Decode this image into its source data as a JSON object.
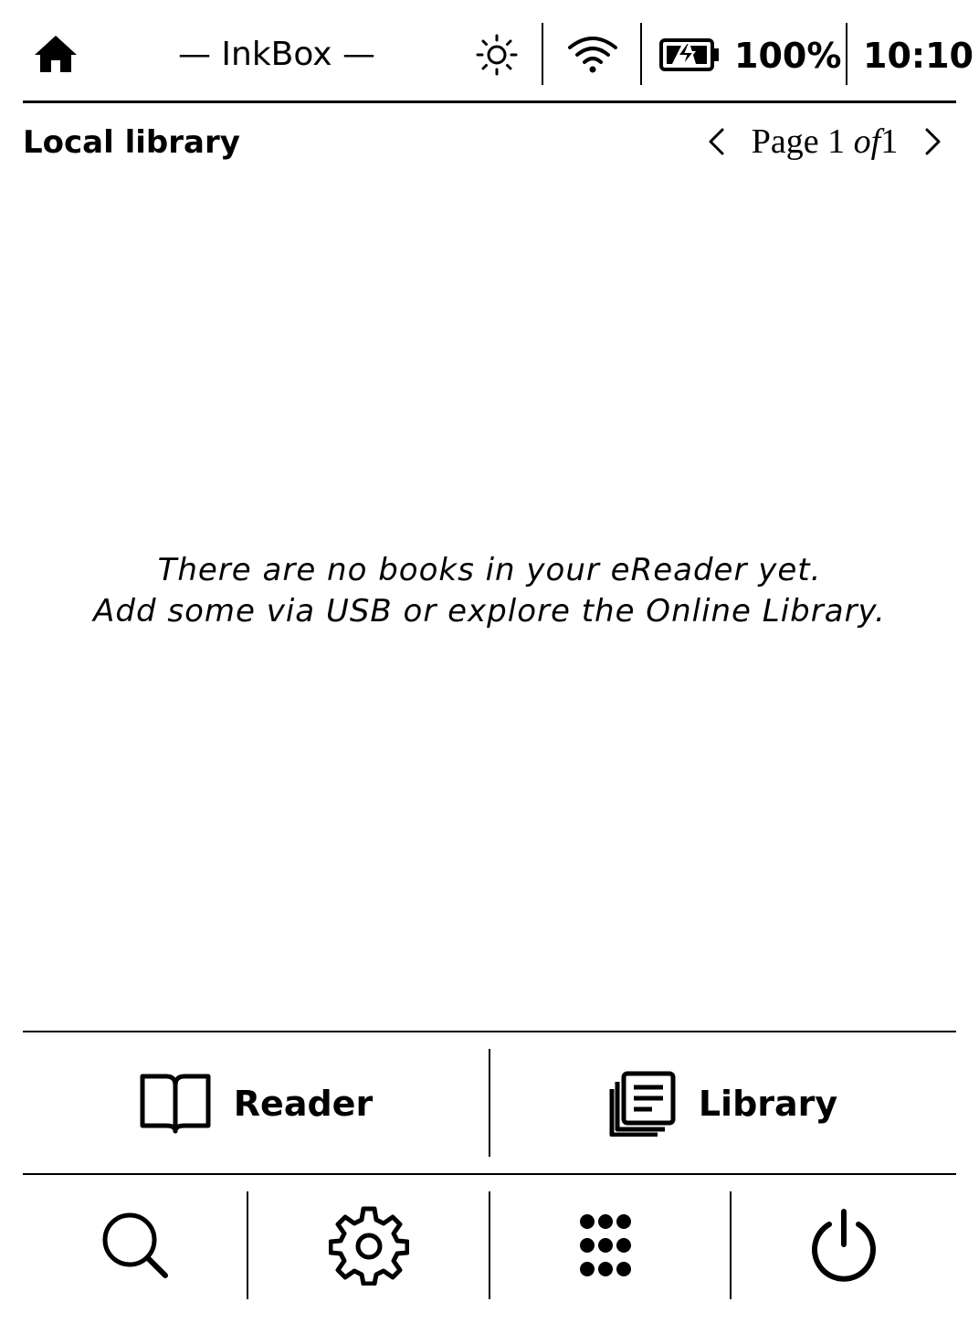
{
  "status_bar": {
    "home_icon": "home-icon",
    "app_title": "— InkBox —",
    "frontlight_icon": "sun-icon",
    "wifi_icon": "wifi-icon",
    "battery_icon": "battery-charging-icon",
    "battery_percent": "100%",
    "clock": "10:10"
  },
  "library_header": {
    "title": "Local library",
    "page_word": "Page",
    "current_page": "1",
    "of_word": "of",
    "total_pages": "1",
    "prev_icon": "chevron-left-icon",
    "next_icon": "chevron-right-icon"
  },
  "empty_state": {
    "line1": "There are no books in your eReader yet.",
    "line2": "Add some via USB or explore the Online Library."
  },
  "main_nav": {
    "reader": {
      "label": "Reader",
      "icon": "open-book-icon"
    },
    "library": {
      "label": "Library",
      "icon": "library-stack-icon"
    }
  },
  "toolbar": [
    {
      "icon": "search-icon"
    },
    {
      "icon": "gear-icon"
    },
    {
      "icon": "apps-grid-icon"
    },
    {
      "icon": "power-icon"
    }
  ],
  "colors": {
    "foreground": "#000000",
    "background": "#ffffff"
  }
}
